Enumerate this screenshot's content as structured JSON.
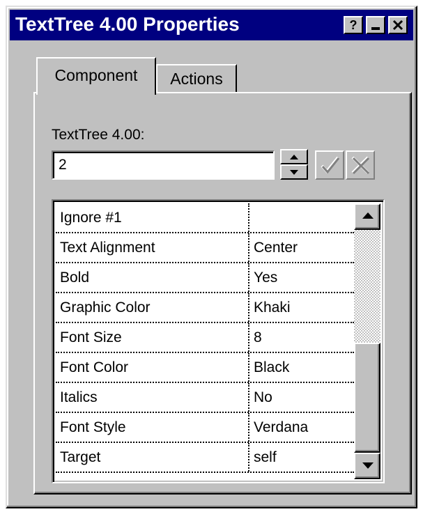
{
  "window": {
    "title": "TextTree 4.00 Properties",
    "buttons": {
      "help": "?"
    }
  },
  "tabs": [
    {
      "label": "Component",
      "active": true
    },
    {
      "label": "Actions",
      "active": false
    }
  ],
  "component": {
    "field_label": "TextTree 4.00:",
    "field_value": "2"
  },
  "properties": [
    {
      "name": "Ignore #1",
      "value": ""
    },
    {
      "name": "Text Alignment",
      "value": "Center"
    },
    {
      "name": "Bold",
      "value": "Yes"
    },
    {
      "name": "Graphic Color",
      "value": "Khaki"
    },
    {
      "name": "Font Size",
      "value": "8"
    },
    {
      "name": "Font Color",
      "value": "Black"
    },
    {
      "name": "Italics",
      "value": "No"
    },
    {
      "name": "Font Style",
      "value": "Verdana"
    },
    {
      "name": "Target",
      "value": "self"
    }
  ],
  "colors": {
    "titlebar": "#000080",
    "face": "#c0c0c0"
  },
  "icons": {
    "spin_up": "triangle-up-icon",
    "spin_down": "triangle-down-icon",
    "accept": "checkmark-icon",
    "cancel": "x-icon",
    "scroll_up": "arrow-up-icon",
    "scroll_down": "arrow-down-icon"
  }
}
